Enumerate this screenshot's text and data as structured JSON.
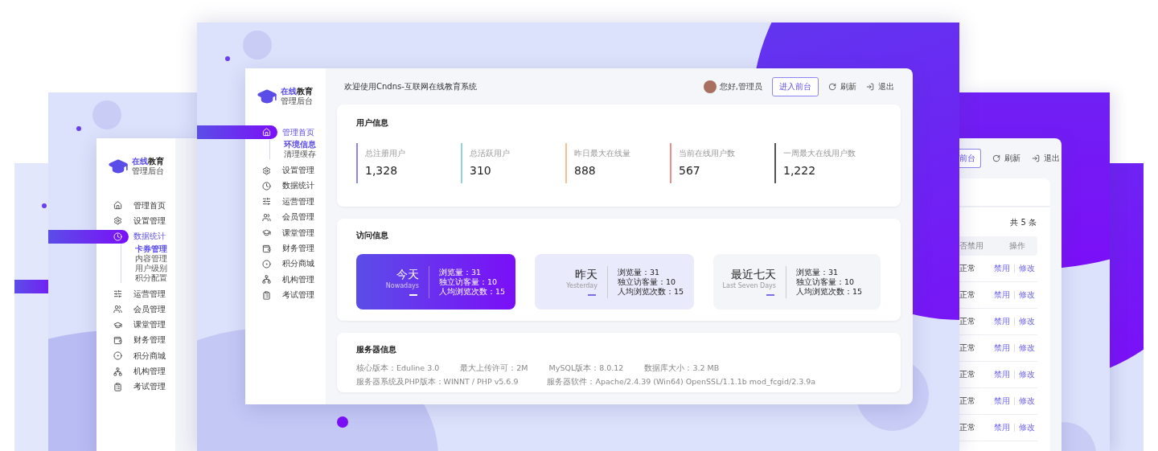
{
  "main": {
    "title": "欢迎使用Cndns-互联网在线教育系统",
    "logo": {
      "accent": "在线",
      "rest": "教育",
      "subtitle": "管理后台"
    },
    "user": {
      "greeting": "您好,管理员"
    },
    "enter_button": "进入前台",
    "refresh": "刷新",
    "logout": "退出",
    "sidebar": {
      "items": [
        {
          "label": "管理首页",
          "selected": true,
          "children": [
            {
              "label": "环境信息",
              "selected": true
            },
            {
              "label": "清理缓存",
              "selected": false
            }
          ]
        },
        {
          "label": "设置管理",
          "selected": false
        },
        {
          "label": "数据统计",
          "selected": false
        },
        {
          "label": "运营管理",
          "selected": false
        },
        {
          "label": "会员管理",
          "selected": false
        },
        {
          "label": "课堂管理",
          "selected": false
        },
        {
          "label": "财务管理",
          "selected": false
        },
        {
          "label": "积分商城",
          "selected": false
        },
        {
          "label": "机构管理",
          "selected": false
        },
        {
          "label": "考试管理",
          "selected": false
        }
      ]
    },
    "user_info": {
      "title": "用户信息",
      "stats": [
        {
          "label": "总注册用户",
          "value": "1,328",
          "color": "#8b87f0"
        },
        {
          "label": "总活跃用户",
          "value": "310",
          "color": "#8fd6d6"
        },
        {
          "label": "昨日最大在线量",
          "value": "888",
          "color": "#f7c08e"
        },
        {
          "label": "当前在线用户数",
          "value": "567",
          "color": "#f28b8b"
        },
        {
          "label": "一周最大在线用户数",
          "value": "1,222",
          "color": "#555555"
        }
      ]
    },
    "visit_info": {
      "title": "访问信息",
      "cards": [
        {
          "kind": "primary",
          "title": "今天",
          "subtitle": "Nowadays",
          "lines": [
            "浏览量：31",
            "独立访客量：10",
            "人均浏览次数：15"
          ]
        },
        {
          "kind": "soft",
          "title": "昨天",
          "subtitle": "Yesterday",
          "lines": [
            "浏览量：31",
            "独立访客量：10",
            "人均浏览次数：15"
          ]
        },
        {
          "kind": "plain",
          "title": "最近七天",
          "subtitle": "Last Seven Days",
          "lines": [
            "浏览量：31",
            "独立访客量：10",
            "人均浏览次数：15"
          ]
        }
      ]
    },
    "server_info": {
      "title": "服务器信息",
      "lines": [
        {
          "items": [
            "核心版本：Eduline 3.0",
            "最大上传许可：2M",
            "MySQL版本：8.0.12",
            "数据库大小：3.2 MB"
          ]
        },
        {
          "items": [
            "服务器系统及PHP版本：WINNT / PHP v5.6.9",
            "服务器软件：Apache/2.4.39 (Win64) OpenSSL/1.1.1b mod_fcgid/2.3.9a"
          ]
        }
      ]
    }
  },
  "left_window": {
    "logo": {
      "accent": "在线",
      "rest": "教育",
      "subtitle": "管理后台"
    },
    "sidebar": {
      "items": [
        {
          "label": "管理首页",
          "selected": false
        },
        {
          "label": "设置管理",
          "selected": false
        },
        {
          "label": "数据统计",
          "selected": true,
          "children": [
            {
              "label": "卡券管理",
              "selected": true
            },
            {
              "label": "内容管理",
              "selected": false
            },
            {
              "label": "用户级别",
              "selected": false
            },
            {
              "label": "积分配置",
              "selected": false
            }
          ]
        },
        {
          "label": "运营管理",
          "selected": false
        },
        {
          "label": "会员管理",
          "selected": false
        },
        {
          "label": "课堂管理",
          "selected": false
        },
        {
          "label": "财务管理",
          "selected": false
        },
        {
          "label": "积分商城",
          "selected": false
        },
        {
          "label": "机构管理",
          "selected": false
        },
        {
          "label": "考试管理",
          "selected": false
        }
      ]
    }
  },
  "right_window": {
    "enter_button": "前台",
    "refresh": "刷新",
    "logout": "退出",
    "total": "共 5 条",
    "columns": [
      "否禁用",
      "操作"
    ],
    "rows": [
      {
        "status": "正常",
        "actions": [
          "禁用",
          "修改"
        ]
      },
      {
        "status": "正常",
        "actions": [
          "禁用",
          "修改"
        ]
      },
      {
        "status": "正常",
        "actions": [
          "禁用",
          "修改"
        ]
      },
      {
        "status": "正常",
        "actions": [
          "禁用",
          "修改"
        ]
      },
      {
        "status": "正常",
        "actions": [
          "禁用",
          "修改"
        ]
      },
      {
        "status": "正常",
        "actions": [
          "禁用",
          "修改"
        ]
      },
      {
        "status": "正常",
        "actions": [
          "禁用",
          "修改"
        ]
      }
    ]
  }
}
